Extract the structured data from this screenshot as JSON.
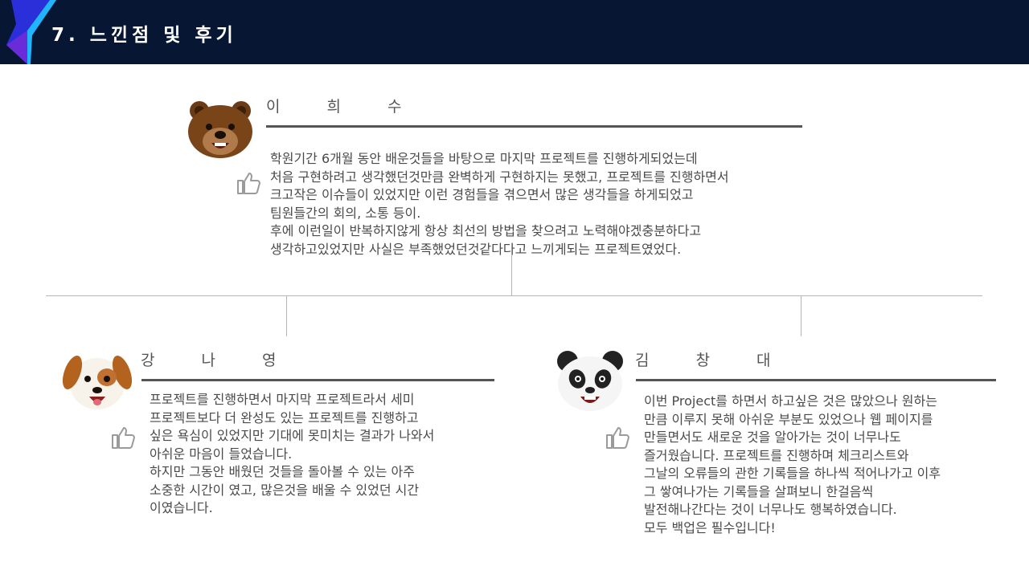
{
  "header": {
    "title": "7. 느낀점 및 후기"
  },
  "reviews": [
    {
      "name": "이 희 수",
      "avatar": "bear",
      "lines": [
        "학원기간 6개월  동안 배운것들을 바탕으로 마지막 프로젝트를 진행하게되었는데",
        "처음 구현하려고 생각했던것만큼 완벽하게 구현하지는 못했고, 프로젝트를 진행하면서",
        "크고작은 이슈들이 있었지만 이런 경험들을 겪으면서 많은 생각들을 하게되었고",
        "팀원들간의 회의, 소통 등이.",
        "후에 이런일이 반복하지않게 항상 최선의 방법을 찾으려고 노력해야겠충분하다고",
        "생각하고있었지만 사실은 부족했었던것같다다고 느끼게되는 프로젝트였었다."
      ]
    },
    {
      "name": "강 나 영",
      "avatar": "dog",
      "lines": [
        "프로젝트를 진행하면서 마지막 프로젝트라서 세미",
        "프로젝트보다 더 완성도 있는 프로젝트를 진행하고",
        "싶은 욕심이 있었지만 기대에 못미치는 결과가 나와서",
        "아쉬운 마음이 들었습니다.",
        "하지만 그동안 배웠던 것들을 돌아볼 수 있는 아주",
        "소중한 시간이 였고, 많은것을 배울 수 있었던 시간",
        "이였습니다."
      ]
    },
    {
      "name": "김 창 대",
      "avatar": "panda",
      "lines": [
        "이번 Project를 하면서 하고싶은 것은 많았으나 원하는",
        "만큼 이루지 못해 아쉬운 부분도 있었으나 웹 페이지를",
        "만들면서도 새로운 것을 알아가는 것이 너무나도",
        "즐거웠습니다. 프로젝트를 진행하며 체크리스트와",
        "그날의 오류들의 관한 기록들을 하나씩 적어나가고 이후",
        "그 쌓여나가는 기록들을 살펴보니 한걸음씩",
        "발전해나간다는 것이 너무나도 행복하였습니다.",
        "모두 백업은 필수입니다!"
      ]
    }
  ]
}
